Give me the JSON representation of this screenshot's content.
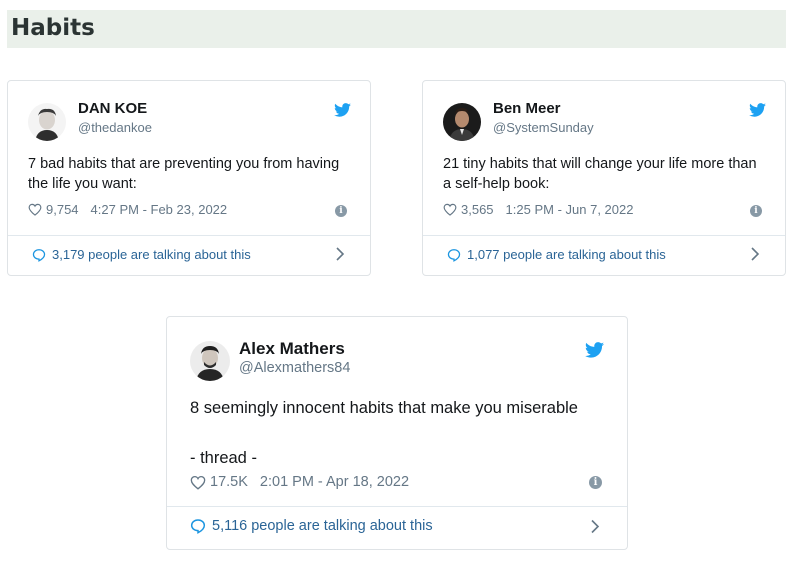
{
  "header": {
    "title": "Habits"
  },
  "colors": {
    "accent": "#1da1f2",
    "link": "#2a6496",
    "muted": "#657786",
    "header_bg": "#eaf0ea"
  },
  "tweets": [
    {
      "name": "DAN KOE",
      "handle": "@thedankoe",
      "text": "7 bad habits that are preventing you from having the life you want:",
      "likes": "9,754",
      "timestamp": "4:27 PM - Feb 23, 2022",
      "talking": "3,179 people are talking about this",
      "icons": [
        "avatar",
        "twitter-bird-icon",
        "heart-icon",
        "info-icon",
        "comment-bubble-icon",
        "chevron-right-icon"
      ]
    },
    {
      "name": "Ben Meer",
      "handle": "@SystemSunday",
      "text": "21 tiny habits that will change your life more than a self-help book:",
      "likes": "3,565",
      "timestamp": "1:25 PM - Jun 7, 2022",
      "talking": "1,077 people are talking about this"
    },
    {
      "name": "Alex Mathers",
      "handle": "@Alexmathers84",
      "text_line1": "8 seemingly innocent habits that make you miserable",
      "text_line2": "- thread -",
      "likes": "17.5K",
      "timestamp": "2:01 PM - Apr 18, 2022",
      "talking": "5,116 people are talking about this"
    }
  ]
}
